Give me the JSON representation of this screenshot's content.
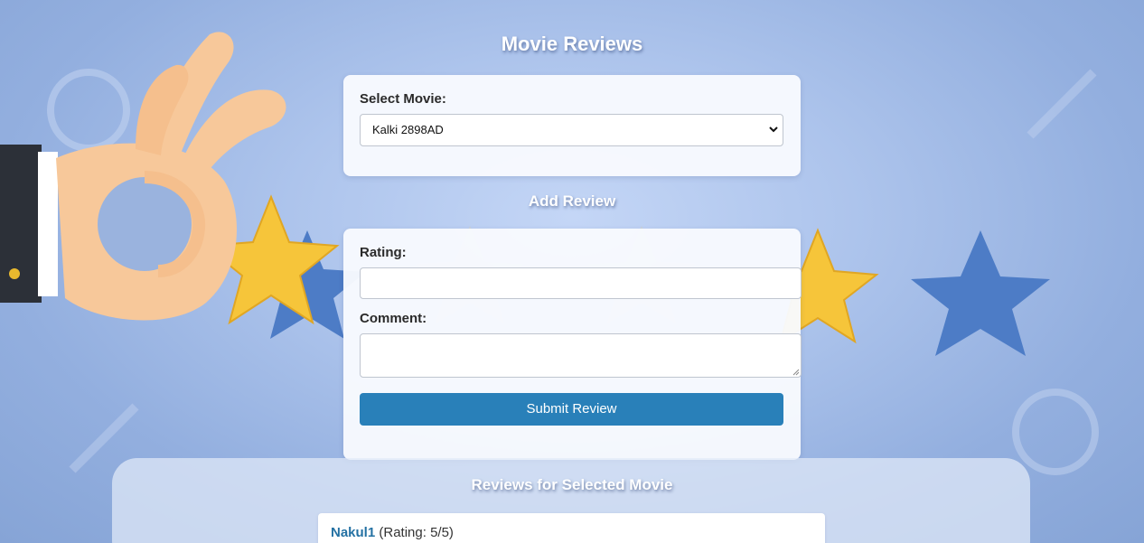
{
  "page": {
    "title": "Movie Reviews"
  },
  "movie_select": {
    "label": "Select Movie:",
    "selected": "Kalki 2898AD"
  },
  "add_review": {
    "title": "Add Review",
    "rating_label": "Rating:",
    "rating_value": "",
    "comment_label": "Comment:",
    "comment_value": "",
    "submit_label": "Submit Review"
  },
  "reviews": {
    "title": "Reviews for Selected Movie",
    "items": [
      {
        "user": "Nakul1",
        "rating_text": "(Rating: 5/5)"
      }
    ]
  },
  "colors": {
    "accent": "#2980b9",
    "reviewer_name": "#2471a3",
    "star_gold": "#f6c53a",
    "star_blue": "#4d7cc6"
  },
  "icons": [
    "ok-hand-icon",
    "star-icon",
    "chevron-down-icon",
    "resize-grip-icon"
  ]
}
